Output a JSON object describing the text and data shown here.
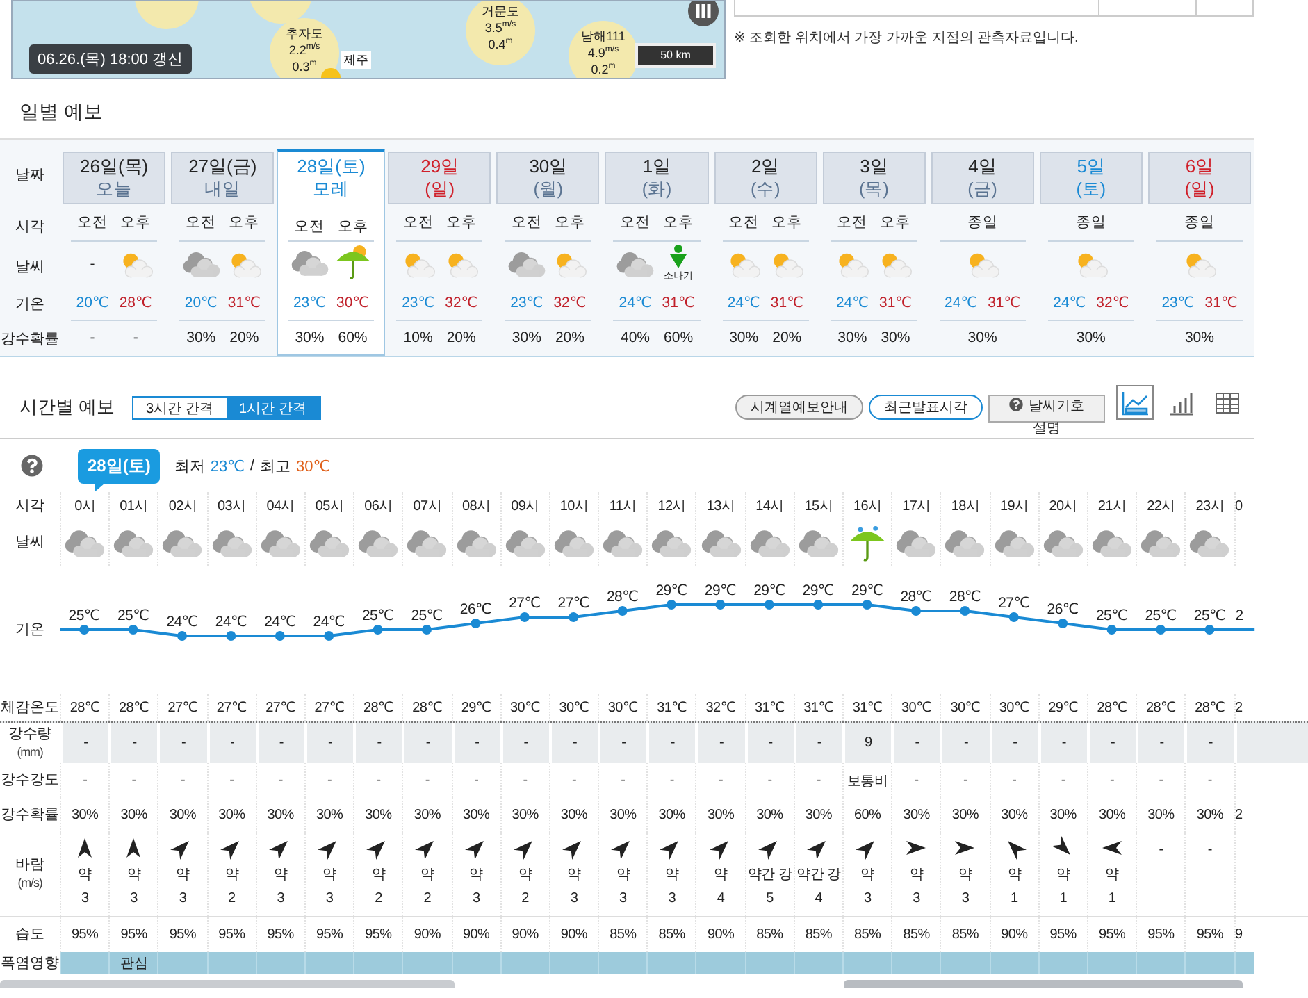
{
  "map": {
    "updated": "06.26.(목) 18:00 갱신",
    "scale": "50 km",
    "place": "제주",
    "stations": [
      {
        "name": "거문도",
        "wind": "3.5",
        "wind_unit": "m/s",
        "wave": "0.4",
        "wave_unit": "m"
      },
      {
        "name": "추자도",
        "wind": "2.2",
        "wind_unit": "m/s",
        "wave": "0.3",
        "wave_unit": "m"
      },
      {
        "name": "남해111",
        "wind": "4.9",
        "wind_unit": "m/s",
        "wave": "0.2",
        "wave_unit": "m"
      }
    ]
  },
  "observation_note": "※ 조회한 위치에서 가장 가까운 지점의 관측자료입니다.",
  "daily": {
    "title": "일별 예보",
    "row_labels": [
      "날짜",
      "시각",
      "날씨",
      "기온",
      "강수확률"
    ],
    "days": [
      {
        "date": "26일(목)",
        "sub": "오늘",
        "kind": "weekday",
        "selected": false,
        "times": [
          "오전",
          "오후"
        ],
        "weather": [
          {
            "kind": "none",
            "label": "-"
          },
          {
            "kind": "partly_cloudy"
          }
        ],
        "low": "20℃",
        "high": "28℃",
        "precip": [
          "-",
          "-"
        ]
      },
      {
        "date": "27일(금)",
        "sub": "내일",
        "kind": "weekday",
        "selected": false,
        "times": [
          "오전",
          "오후"
        ],
        "weather": [
          {
            "kind": "cloudy"
          },
          {
            "kind": "partly_cloudy"
          }
        ],
        "low": "20℃",
        "high": "31℃",
        "precip": [
          "30%",
          "20%"
        ]
      },
      {
        "date": "28일(토)",
        "sub": "모레",
        "kind": "saturday",
        "selected": true,
        "times": [
          "오전",
          "오후"
        ],
        "weather": [
          {
            "kind": "cloudy"
          },
          {
            "kind": "rain_sun"
          }
        ],
        "low": "23℃",
        "high": "30℃",
        "precip": [
          "30%",
          "60%"
        ]
      },
      {
        "date": "29일",
        "sub": "(일)",
        "kind": "sunday",
        "selected": false,
        "times": [
          "오전",
          "오후"
        ],
        "weather": [
          {
            "kind": "partly_cloudy"
          },
          {
            "kind": "partly_cloudy"
          }
        ],
        "low": "23℃",
        "high": "32℃",
        "precip": [
          "10%",
          "20%"
        ]
      },
      {
        "date": "30일",
        "sub": "(월)",
        "kind": "weekday",
        "selected": false,
        "times": [
          "오전",
          "오후"
        ],
        "weather": [
          {
            "kind": "cloudy"
          },
          {
            "kind": "partly_cloudy"
          }
        ],
        "low": "23℃",
        "high": "32℃",
        "precip": [
          "30%",
          "20%"
        ]
      },
      {
        "date": "1일",
        "sub": "(화)",
        "kind": "weekday",
        "selected": false,
        "times": [
          "오전",
          "오후"
        ],
        "weather": [
          {
            "kind": "cloudy"
          },
          {
            "kind": "shower",
            "label": "소나기"
          }
        ],
        "low": "24℃",
        "high": "31℃",
        "precip": [
          "40%",
          "60%"
        ]
      },
      {
        "date": "2일",
        "sub": "(수)",
        "kind": "weekday",
        "selected": false,
        "times": [
          "오전",
          "오후"
        ],
        "weather": [
          {
            "kind": "partly_cloudy"
          },
          {
            "kind": "partly_cloudy"
          }
        ],
        "low": "24℃",
        "high": "31℃",
        "precip": [
          "30%",
          "20%"
        ]
      },
      {
        "date": "3일",
        "sub": "(목)",
        "kind": "weekday",
        "selected": false,
        "times": [
          "오전",
          "오후"
        ],
        "weather": [
          {
            "kind": "partly_cloudy"
          },
          {
            "kind": "partly_cloudy"
          }
        ],
        "low": "24℃",
        "high": "31℃",
        "precip": [
          "30%",
          "30%"
        ]
      },
      {
        "date": "4일",
        "sub": "(금)",
        "kind": "weekday",
        "selected": false,
        "times": [
          "종일"
        ],
        "weather": [
          {
            "kind": "partly_cloudy"
          }
        ],
        "low": "24℃",
        "high": "31℃",
        "precip": [
          "30%"
        ]
      },
      {
        "date": "5일",
        "sub": "(토)",
        "kind": "saturday",
        "selected": false,
        "times": [
          "종일"
        ],
        "weather": [
          {
            "kind": "partly_cloudy"
          }
        ],
        "low": "24℃",
        "high": "32℃",
        "precip": [
          "30%"
        ]
      },
      {
        "date": "6일",
        "sub": "(일)",
        "kind": "sunday",
        "selected": false,
        "times": [
          "종일"
        ],
        "weather": [
          {
            "kind": "partly_cloudy"
          }
        ],
        "low": "23℃",
        "high": "31℃",
        "precip": [
          "30%"
        ]
      }
    ]
  },
  "hourly": {
    "title": "시간별 예보",
    "tabs": [
      {
        "label": "3시간 간격",
        "selected": false
      },
      {
        "label": "1시간 간격",
        "selected": true
      }
    ],
    "buttons": [
      {
        "label": "시계열예보안내",
        "selected": false
      },
      {
        "label": "최근발표시각",
        "selected": true
      }
    ],
    "symbol_help": "날씨기호 설명",
    "views": [
      {
        "kind": "line",
        "selected": true
      },
      {
        "kind": "bar",
        "selected": false
      },
      {
        "kind": "table",
        "selected": false
      }
    ],
    "day_badge": "28일(토)",
    "min_label": "최저",
    "min": "23℃",
    "separator": "/",
    "max_label": "최고",
    "max": "30℃",
    "row_labels": [
      {
        "label": "시각"
      },
      {
        "label": "날씨"
      },
      {
        "label": "기온"
      },
      {
        "label": "체감온도"
      },
      {
        "label": "강수량",
        "unit": "(mm)"
      },
      {
        "label": "강수강도"
      },
      {
        "label": "강수확률"
      },
      {
        "label": "바람",
        "unit": "(m/s)"
      },
      {
        "label": "습도"
      },
      {
        "label": "폭염영향"
      }
    ],
    "columns": [
      {
        "t": "0시",
        "kind": "cloudy",
        "temp": "25℃",
        "feels": "28℃",
        "rain": "-",
        "intensity": "-",
        "prob": "30%",
        "wind": {
          "kind": "N",
          "strength": "약",
          "speed": "3"
        },
        "hum": "95%"
      },
      {
        "t": "01시",
        "kind": "cloudy",
        "temp": "25℃",
        "feels": "28℃",
        "rain": "-",
        "intensity": "-",
        "prob": "30%",
        "wind": {
          "kind": "N",
          "strength": "약",
          "speed": "3"
        },
        "hum": "95%",
        "heat": "관심"
      },
      {
        "t": "02시",
        "kind": "cloudy",
        "temp": "24℃",
        "feels": "27℃",
        "rain": "-",
        "intensity": "-",
        "prob": "30%",
        "wind": {
          "kind": "NE",
          "strength": "약",
          "speed": "3"
        },
        "hum": "95%"
      },
      {
        "t": "03시",
        "kind": "cloudy",
        "temp": "24℃",
        "feels": "27℃",
        "rain": "-",
        "intensity": "-",
        "prob": "30%",
        "wind": {
          "kind": "NE",
          "strength": "약",
          "speed": "2"
        },
        "hum": "95%"
      },
      {
        "t": "04시",
        "kind": "cloudy",
        "temp": "24℃",
        "feels": "27℃",
        "rain": "-",
        "intensity": "-",
        "prob": "30%",
        "wind": {
          "kind": "NE",
          "strength": "약",
          "speed": "3"
        },
        "hum": "95%"
      },
      {
        "t": "05시",
        "kind": "cloudy",
        "temp": "24℃",
        "feels": "27℃",
        "rain": "-",
        "intensity": "-",
        "prob": "30%",
        "wind": {
          "kind": "NE",
          "strength": "약",
          "speed": "3"
        },
        "hum": "95%"
      },
      {
        "t": "06시",
        "kind": "cloudy",
        "temp": "25℃",
        "feels": "28℃",
        "rain": "-",
        "intensity": "-",
        "prob": "30%",
        "wind": {
          "kind": "NE",
          "strength": "약",
          "speed": "2"
        },
        "hum": "95%"
      },
      {
        "t": "07시",
        "kind": "cloudy",
        "temp": "25℃",
        "feels": "28℃",
        "rain": "-",
        "intensity": "-",
        "prob": "30%",
        "wind": {
          "kind": "NE",
          "strength": "약",
          "speed": "2"
        },
        "hum": "90%"
      },
      {
        "t": "08시",
        "kind": "cloudy",
        "temp": "26℃",
        "feels": "29℃",
        "rain": "-",
        "intensity": "-",
        "prob": "30%",
        "wind": {
          "kind": "NE",
          "strength": "약",
          "speed": "3"
        },
        "hum": "90%"
      },
      {
        "t": "09시",
        "kind": "cloudy",
        "temp": "27℃",
        "feels": "30℃",
        "rain": "-",
        "intensity": "-",
        "prob": "30%",
        "wind": {
          "kind": "NE",
          "strength": "약",
          "speed": "2"
        },
        "hum": "90%"
      },
      {
        "t": "10시",
        "kind": "cloudy",
        "temp": "27℃",
        "feels": "30℃",
        "rain": "-",
        "intensity": "-",
        "prob": "30%",
        "wind": {
          "kind": "NE",
          "strength": "약",
          "speed": "3"
        },
        "hum": "90%"
      },
      {
        "t": "11시",
        "kind": "cloudy",
        "temp": "28℃",
        "feels": "30℃",
        "rain": "-",
        "intensity": "-",
        "prob": "30%",
        "wind": {
          "kind": "NE",
          "strength": "약",
          "speed": "3"
        },
        "hum": "85%"
      },
      {
        "t": "12시",
        "kind": "cloudy",
        "temp": "29℃",
        "feels": "31℃",
        "rain": "-",
        "intensity": "-",
        "prob": "30%",
        "wind": {
          "kind": "NE",
          "strength": "약",
          "speed": "3"
        },
        "hum": "85%"
      },
      {
        "t": "13시",
        "kind": "cloudy",
        "temp": "29℃",
        "feels": "32℃",
        "rain": "-",
        "intensity": "-",
        "prob": "30%",
        "wind": {
          "kind": "NE",
          "strength": "약",
          "speed": "4"
        },
        "hum": "90%"
      },
      {
        "t": "14시",
        "kind": "cloudy",
        "temp": "29℃",
        "feels": "31℃",
        "rain": "-",
        "intensity": "-",
        "prob": "30%",
        "wind": {
          "kind": "NE",
          "strength": "약간 강",
          "speed": "5"
        },
        "hum": "85%"
      },
      {
        "t": "15시",
        "kind": "cloudy",
        "temp": "29℃",
        "feels": "31℃",
        "rain": "-",
        "intensity": "-",
        "prob": "30%",
        "wind": {
          "kind": "NE",
          "strength": "약간 강",
          "speed": "4"
        },
        "hum": "85%"
      },
      {
        "t": "16시",
        "kind": "rain",
        "temp": "29℃",
        "feels": "31℃",
        "rain": "9",
        "intensity": "보통비",
        "prob": "60%",
        "wind": {
          "kind": "NE",
          "strength": "약",
          "speed": "3"
        },
        "hum": "85%"
      },
      {
        "t": "17시",
        "kind": "cloudy",
        "temp": "28℃",
        "feels": "30℃",
        "rain": "-",
        "intensity": "-",
        "prob": "30%",
        "wind": {
          "kind": "E",
          "strength": "약",
          "speed": "3"
        },
        "hum": "85%"
      },
      {
        "t": "18시",
        "kind": "cloudy",
        "temp": "28℃",
        "feels": "30℃",
        "rain": "-",
        "intensity": "-",
        "prob": "30%",
        "wind": {
          "kind": "E",
          "strength": "약",
          "speed": "3"
        },
        "hum": "85%"
      },
      {
        "t": "19시",
        "kind": "cloudy",
        "temp": "27℃",
        "feels": "30℃",
        "rain": "-",
        "intensity": "-",
        "prob": "30%",
        "wind": {
          "kind": "NW",
          "strength": "약",
          "speed": "1"
        },
        "hum": "90%"
      },
      {
        "t": "20시",
        "kind": "cloudy",
        "temp": "26℃",
        "feels": "29℃",
        "rain": "-",
        "intensity": "-",
        "prob": "30%",
        "wind": {
          "kind": "SE",
          "strength": "약",
          "speed": "1"
        },
        "hum": "95%"
      },
      {
        "t": "21시",
        "kind": "cloudy",
        "temp": "25℃",
        "feels": "28℃",
        "rain": "-",
        "intensity": "-",
        "prob": "30%",
        "wind": {
          "kind": "W",
          "strength": "약",
          "speed": "1"
        },
        "hum": "95%"
      },
      {
        "t": "22시",
        "kind": "cloudy",
        "temp": "25℃",
        "feels": "28℃",
        "rain": "-",
        "intensity": "-",
        "prob": "30%",
        "wind": {
          "kind": "calm",
          "strength": "-"
        },
        "hum": "95%"
      },
      {
        "t": "23시",
        "kind": "cloudy",
        "temp": "25℃",
        "feels": "28℃",
        "rain": "-",
        "intensity": "-",
        "prob": "30%",
        "wind": {
          "kind": "calm",
          "strength": "-"
        },
        "hum": "95%"
      },
      {
        "t": "0",
        "cut": true,
        "temp": "2",
        "feels": "2",
        "prob": "2",
        "hum": "9"
      }
    ]
  }
}
